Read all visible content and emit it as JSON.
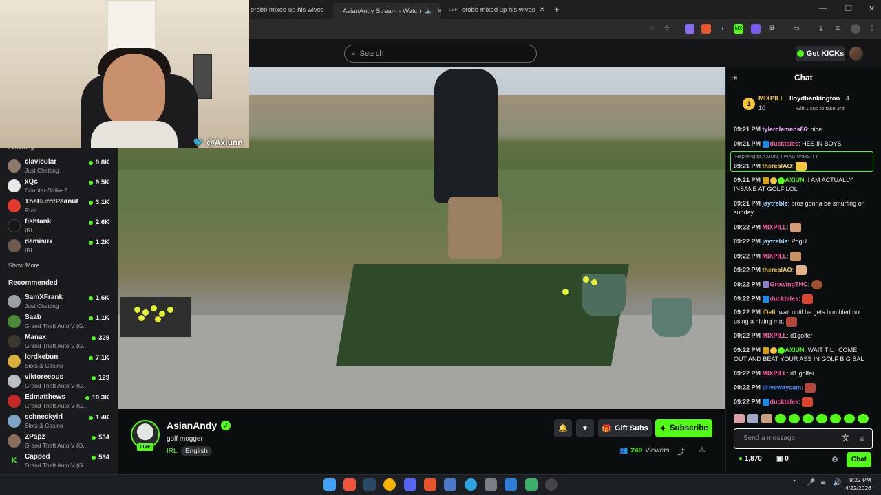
{
  "browser": {
    "tabs": [
      {
        "label": "erobb mixed up his wives : r/Li",
        "active": false
      },
      {
        "label": "AsianAndy Stream - Watch",
        "active": true
      },
      {
        "label": "erobb mixed up his wives",
        "active": false
      }
    ],
    "new_tab": "+"
  },
  "header": {
    "search_placeholder": "Search",
    "get_kicks_label": "Get KICKs"
  },
  "webcam": {
    "twitter_handle": "@Axiunn"
  },
  "sidebar": {
    "following_label": "Following",
    "following": [
      {
        "name": "clavicular",
        "category": "Just Chatting",
        "viewers": "9.8K"
      },
      {
        "name": "xQc",
        "category": "Counter-Strike 2",
        "viewers": "9.5K"
      },
      {
        "name": "TheBurntPeanut",
        "category": "Rust",
        "viewers": "3.1K"
      },
      {
        "name": "fishtank",
        "category": "IRL",
        "viewers": "2.6K"
      },
      {
        "name": "demisux",
        "category": "IRL",
        "viewers": "1.2K"
      }
    ],
    "show_more": "Show More",
    "recommended_label": "Recommended",
    "recommended": [
      {
        "name": "SamXFrank",
        "category": "Just Chatting",
        "viewers": "1.6K"
      },
      {
        "name": "Saab",
        "category": "Grand Theft Auto V (G...",
        "viewers": "1.1K"
      },
      {
        "name": "Manax",
        "category": "Grand Theft Auto V (G...",
        "viewers": "329"
      },
      {
        "name": "lordkebun",
        "category": "Slots & Casino",
        "viewers": "7.1K"
      },
      {
        "name": "viktoreeous",
        "category": "Grand Theft Auto V (G...",
        "viewers": "129"
      },
      {
        "name": "Edmatthews",
        "category": "Grand Theft Auto V (G...",
        "viewers": "10.3K"
      },
      {
        "name": "schneckyirl",
        "category": "Slots & Casino",
        "viewers": "1.4K"
      },
      {
        "name": "ZPapz",
        "category": "Grand Theft Auto V (G...",
        "viewers": "534"
      },
      {
        "name": "Capped",
        "category": "Grand Theft Auto V (G...",
        "viewers": "534"
      }
    ]
  },
  "stream": {
    "streamer": "AsianAndy",
    "live_badge": "LIVE",
    "title": "golf mogger",
    "category": "IRL",
    "language": "English",
    "gift_subs_label": "Gift Subs",
    "subscribe_label": "Subscribe",
    "viewer_count": "249",
    "viewers_label": "Viewers"
  },
  "chat": {
    "title": "Chat",
    "pinned": {
      "rank": "1",
      "user1": "MIXPILL",
      "user1_count": "10",
      "user2": "lloydbankington",
      "user2_count": "4",
      "gift_note": "Gift 1 sub to take 3rd"
    },
    "reply_context": "Replying to AXIUN: I WAS VARSITY",
    "messages": [
      {
        "time": "09:21 PM",
        "user": "tylerclemens86",
        "text": "nice",
        "color": "#f3b6ff"
      },
      {
        "time": "09:21 PM",
        "user": "ducktales",
        "text": "HES IN BOYS",
        "color": "#ff5ca8"
      },
      {
        "time": "09:21 PM",
        "user": "therealAO",
        "text": "",
        "color": "#f0c95a"
      },
      {
        "time": "09:21 PM",
        "user": "AXIUN",
        "text": "I AM ACTUALLY INSANE AT GOLF LOL",
        "color": "#53fc18"
      },
      {
        "time": "09:21 PM",
        "user": "jaytreble",
        "text": "bros gonna be smurfing on sunday",
        "color": "#a7d7ff"
      },
      {
        "time": "09:22 PM",
        "user": "MIXPILL",
        "text": "",
        "color": "#ff5ca8"
      },
      {
        "time": "09:22 PM",
        "user": "jaytreble",
        "text": "PogU",
        "color": "#a7d7ff"
      },
      {
        "time": "09:22 PM",
        "user": "MIXPILL",
        "text": "",
        "color": "#ff5ca8"
      },
      {
        "time": "09:22 PM",
        "user": "therealAO",
        "text": "",
        "color": "#f0c95a"
      },
      {
        "time": "09:22 PM",
        "user": "GrowingTHC",
        "text": "",
        "color": "#ff5ca8"
      },
      {
        "time": "09:22 PM",
        "user": "ducktales",
        "text": "",
        "color": "#ff5ca8"
      },
      {
        "time": "09:22 PM",
        "user": "iDeli",
        "text": "wait until he gets humbled not using a hitting mat",
        "color": "#f0c95a"
      },
      {
        "time": "09:22 PM",
        "user": "MIXPILL",
        "text": "d1golfer",
        "color": "#ff5ca8"
      },
      {
        "time": "09:22 PM",
        "user": "AXIUN",
        "text": "WAIT TIL I COME OUT AND BEAT YOUR ASS IN GOLF BIG SAL",
        "color": "#53fc18"
      },
      {
        "time": "09:22 PM",
        "user": "MIXPILL",
        "text": "d1 golfer",
        "color": "#ff5ca8"
      },
      {
        "time": "09:22 PM",
        "user": "drivewaycam",
        "text": "",
        "color": "#4f8cff"
      },
      {
        "time": "09:22 PM",
        "user": "ducktales",
        "text": "",
        "color": "#ff5ca8"
      }
    ],
    "input_placeholder": "Send a message",
    "kicks_balance": "1,870",
    "chest_count": "0",
    "send_label": "Chat"
  },
  "taskbar": {
    "time": "9:22 PM",
    "date": "4/22/2026"
  },
  "colors": {
    "kick_green": "#53fc18",
    "sidebar_bg": "#191b1f",
    "page_bg": "#0b0e0f"
  }
}
